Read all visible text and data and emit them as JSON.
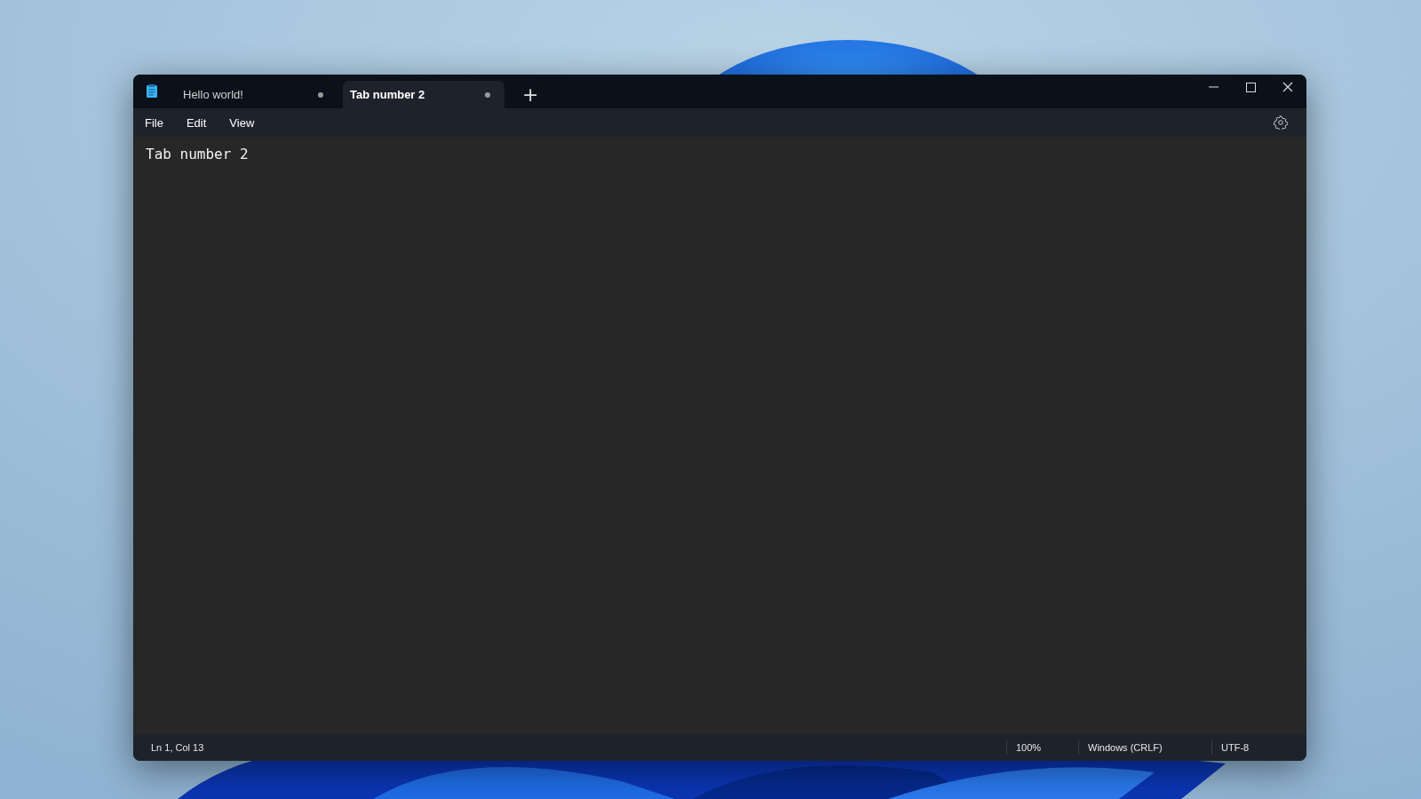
{
  "tabs": [
    {
      "label": "Hello world!",
      "selected": false,
      "unsaved": true
    },
    {
      "label": "Tab number 2",
      "selected": true,
      "unsaved": true
    }
  ],
  "new_tab": "+",
  "menu": [
    "File",
    "Edit",
    "View"
  ],
  "editor": {
    "text": "Tab number 2"
  },
  "status_bar": {
    "position": "Ln 1, Col 13",
    "zoom": "100%",
    "line_ending": "Windows (CRLF)",
    "encoding": "UTF-8"
  }
}
